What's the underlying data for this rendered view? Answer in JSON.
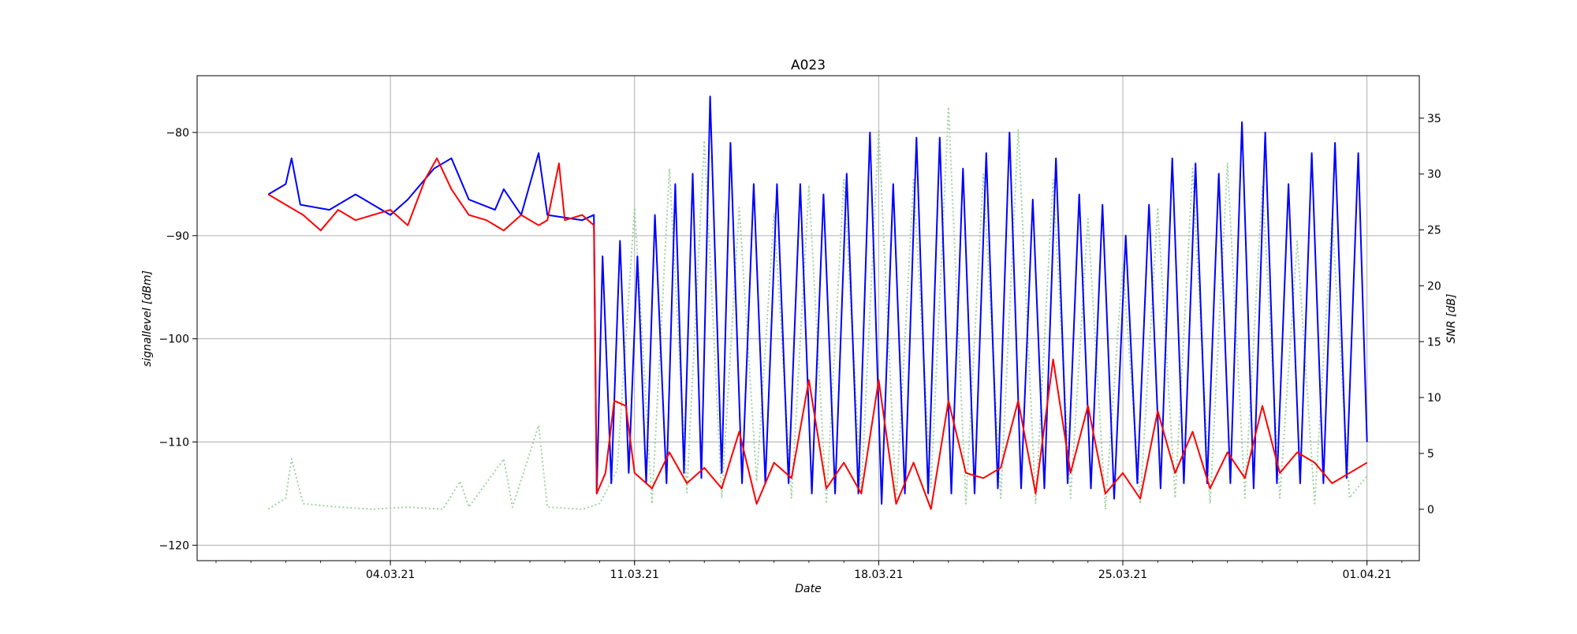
{
  "chart_data": {
    "type": "line",
    "title": "A023",
    "xlabel": "Date",
    "ylabel_left": "signallevel [dBm]",
    "ylabel_right": "SNR [dB]",
    "x_range": [
      "2021-02-26T11:00",
      "2021-04-02T12:00"
    ],
    "ylim_left": [
      -121.5,
      -74.5
    ],
    "ylim_right": [
      -4.6,
      38.8
    ],
    "grid": true,
    "x_ticks": [
      {
        "date": "2021-03-04",
        "label": "04.03.21"
      },
      {
        "date": "2021-03-11",
        "label": "11.03.21"
      },
      {
        "date": "2021-03-18",
        "label": "18.03.21"
      },
      {
        "date": "2021-03-25",
        "label": "25.03.21"
      },
      {
        "date": "2021-04-01",
        "label": "01.04.21"
      }
    ],
    "y_ticks_left": [
      -80,
      -90,
      -100,
      -110,
      -120
    ],
    "y_tick_labels_left": [
      "−80",
      "−90",
      "−100",
      "−110",
      "−120"
    ],
    "y_ticks_right": [
      35,
      30,
      25,
      20,
      15,
      10,
      5,
      0
    ],
    "y_tick_labels_right": [
      "35",
      "30",
      "25",
      "20",
      "15",
      "10",
      "5",
      "0"
    ],
    "series": [
      {
        "axis": "left",
        "color": "#0000ff",
        "style": "solid",
        "points": [
          [
            "2021-02-28T12:00",
            -86.0
          ],
          [
            "2021-03-01T00:00",
            -85.0
          ],
          [
            "2021-03-01T04:00",
            -82.5
          ],
          [
            "2021-03-01T10:00",
            -87.0
          ],
          [
            "2021-03-02T06:00",
            -87.5
          ],
          [
            "2021-03-03T00:00",
            -86.0
          ],
          [
            "2021-03-04T00:00",
            -88.0
          ],
          [
            "2021-03-04T12:00",
            -86.5
          ],
          [
            "2021-03-05T06:00",
            -83.5
          ],
          [
            "2021-03-05T18:00",
            -82.5
          ],
          [
            "2021-03-06T06:00",
            -86.5
          ],
          [
            "2021-03-07T00:00",
            -87.5
          ],
          [
            "2021-03-07T06:00",
            -85.5
          ],
          [
            "2021-03-07T18:00",
            -88.0
          ],
          [
            "2021-03-08T06:00",
            -82.0
          ],
          [
            "2021-03-08T12:00",
            -88.0
          ],
          [
            "2021-03-09T12:00",
            -88.5
          ],
          [
            "2021-03-09T20:00",
            -88.0
          ],
          [
            "2021-03-09T22:00",
            -115.0
          ],
          [
            "2021-03-10T02:00",
            -92.0
          ],
          [
            "2021-03-10T08:00",
            -114.0
          ],
          [
            "2021-03-10T14:00",
            -90.5
          ],
          [
            "2021-03-10T20:00",
            -113.0
          ],
          [
            "2021-03-11T02:00",
            -92.0
          ],
          [
            "2021-03-11T08:00",
            -114.0
          ],
          [
            "2021-03-11T14:00",
            -88.0
          ],
          [
            "2021-03-11T22:00",
            -114.0
          ],
          [
            "2021-03-12T04:00",
            -85.0
          ],
          [
            "2021-03-12T10:00",
            -113.0
          ],
          [
            "2021-03-12T16:00",
            -84.0
          ],
          [
            "2021-03-12T22:00",
            -113.5
          ],
          [
            "2021-03-13T04:00",
            -76.5
          ],
          [
            "2021-03-13T12:00",
            -113.0
          ],
          [
            "2021-03-13T18:00",
            -81.0
          ],
          [
            "2021-03-14T02:00",
            -114.0
          ],
          [
            "2021-03-14T10:00",
            -85.0
          ],
          [
            "2021-03-14T18:00",
            -114.0
          ],
          [
            "2021-03-15T02:00",
            -85.0
          ],
          [
            "2021-03-15T10:00",
            -114.0
          ],
          [
            "2021-03-15T18:00",
            -85.0
          ],
          [
            "2021-03-16T02:00",
            -115.0
          ],
          [
            "2021-03-16T10:00",
            -86.0
          ],
          [
            "2021-03-16T18:00",
            -115.0
          ],
          [
            "2021-03-17T02:00",
            -84.0
          ],
          [
            "2021-03-17T10:00",
            -115.0
          ],
          [
            "2021-03-17T18:00",
            -80.0
          ],
          [
            "2021-03-18T02:00",
            -116.0
          ],
          [
            "2021-03-18T10:00",
            -85.0
          ],
          [
            "2021-03-18T18:00",
            -115.0
          ],
          [
            "2021-03-19T02:00",
            -80.5
          ],
          [
            "2021-03-19T10:00",
            -115.0
          ],
          [
            "2021-03-19T18:00",
            -80.5
          ],
          [
            "2021-03-20T02:00",
            -115.0
          ],
          [
            "2021-03-20T10:00",
            -83.5
          ],
          [
            "2021-03-20T18:00",
            -115.0
          ],
          [
            "2021-03-21T02:00",
            -82.0
          ],
          [
            "2021-03-21T10:00",
            -114.5
          ],
          [
            "2021-03-21T18:00",
            -80.0
          ],
          [
            "2021-03-22T02:00",
            -114.5
          ],
          [
            "2021-03-22T10:00",
            -86.5
          ],
          [
            "2021-03-22T18:00",
            -114.5
          ],
          [
            "2021-03-23T02:00",
            -82.5
          ],
          [
            "2021-03-23T10:00",
            -114.0
          ],
          [
            "2021-03-23T18:00",
            -86.0
          ],
          [
            "2021-03-24T02:00",
            -114.5
          ],
          [
            "2021-03-24T10:00",
            -87.0
          ],
          [
            "2021-03-24T18:00",
            -115.5
          ],
          [
            "2021-03-25T02:00",
            -90.0
          ],
          [
            "2021-03-25T10:00",
            -114.0
          ],
          [
            "2021-03-25T18:00",
            -87.0
          ],
          [
            "2021-03-26T02:00",
            -114.5
          ],
          [
            "2021-03-26T10:00",
            -82.5
          ],
          [
            "2021-03-26T18:00",
            -114.0
          ],
          [
            "2021-03-27T02:00",
            -83.0
          ],
          [
            "2021-03-27T10:00",
            -114.0
          ],
          [
            "2021-03-27T18:00",
            -84.0
          ],
          [
            "2021-03-28T02:00",
            -114.0
          ],
          [
            "2021-03-28T10:00",
            -79.0
          ],
          [
            "2021-03-28T18:00",
            -114.5
          ],
          [
            "2021-03-29T02:00",
            -80.0
          ],
          [
            "2021-03-29T10:00",
            -114.0
          ],
          [
            "2021-03-29T18:00",
            -85.0
          ],
          [
            "2021-03-30T02:00",
            -114.0
          ],
          [
            "2021-03-30T10:00",
            -82.0
          ],
          [
            "2021-03-30T18:00",
            -114.0
          ],
          [
            "2021-03-31T02:00",
            -81.0
          ],
          [
            "2021-03-31T10:00",
            -113.5
          ],
          [
            "2021-03-31T18:00",
            -82.0
          ],
          [
            "2021-04-01T00:00",
            -110.0
          ]
        ]
      },
      {
        "axis": "left",
        "color": "#ff0000",
        "style": "solid",
        "points": [
          [
            "2021-02-28T12:00",
            -86.0
          ],
          [
            "2021-03-01T00:00",
            -87.0
          ],
          [
            "2021-03-01T12:00",
            -88.0
          ],
          [
            "2021-03-02T00:00",
            -89.5
          ],
          [
            "2021-03-02T12:00",
            -87.5
          ],
          [
            "2021-03-03T00:00",
            -88.5
          ],
          [
            "2021-03-03T12:00",
            -88.0
          ],
          [
            "2021-03-04T00:00",
            -87.5
          ],
          [
            "2021-03-04T12:00",
            -89.0
          ],
          [
            "2021-03-05T00:00",
            -84.5
          ],
          [
            "2021-03-05T08:00",
            -82.5
          ],
          [
            "2021-03-05T18:00",
            -85.5
          ],
          [
            "2021-03-06T06:00",
            -88.0
          ],
          [
            "2021-03-06T18:00",
            -88.5
          ],
          [
            "2021-03-07T06:00",
            -89.5
          ],
          [
            "2021-03-07T18:00",
            -88.0
          ],
          [
            "2021-03-08T06:00",
            -89.0
          ],
          [
            "2021-03-08T12:00",
            -88.5
          ],
          [
            "2021-03-08T20:00",
            -83.0
          ],
          [
            "2021-03-09T00:00",
            -88.5
          ],
          [
            "2021-03-09T12:00",
            -88.0
          ],
          [
            "2021-03-09T20:00",
            -89.0
          ],
          [
            "2021-03-09T22:00",
            -115.0
          ],
          [
            "2021-03-10T04:00",
            -113.0
          ],
          [
            "2021-03-10T10:00",
            -106.0
          ],
          [
            "2021-03-10T18:00",
            -106.5
          ],
          [
            "2021-03-11T00:00",
            -113.0
          ],
          [
            "2021-03-11T12:00",
            -114.5
          ],
          [
            "2021-03-12T00:00",
            -111.0
          ],
          [
            "2021-03-12T12:00",
            -114.0
          ],
          [
            "2021-03-13T00:00",
            -112.5
          ],
          [
            "2021-03-13T12:00",
            -114.5
          ],
          [
            "2021-03-14T00:00",
            -109.0
          ],
          [
            "2021-03-14T12:00",
            -116.0
          ],
          [
            "2021-03-15T00:00",
            -112.0
          ],
          [
            "2021-03-15T12:00",
            -113.5
          ],
          [
            "2021-03-16T00:00",
            -104.0
          ],
          [
            "2021-03-16T12:00",
            -114.5
          ],
          [
            "2021-03-17T00:00",
            -112.0
          ],
          [
            "2021-03-17T12:00",
            -115.0
          ],
          [
            "2021-03-18T00:00",
            -104.0
          ],
          [
            "2021-03-18T12:00",
            -116.0
          ],
          [
            "2021-03-19T00:00",
            -112.0
          ],
          [
            "2021-03-19T12:00",
            -116.5
          ],
          [
            "2021-03-20T00:00",
            -106.0
          ],
          [
            "2021-03-20T12:00",
            -113.0
          ],
          [
            "2021-03-21T00:00",
            -113.5
          ],
          [
            "2021-03-21T12:00",
            -112.5
          ],
          [
            "2021-03-22T00:00",
            -106.0
          ],
          [
            "2021-03-22T12:00",
            -115.0
          ],
          [
            "2021-03-23T00:00",
            -102.0
          ],
          [
            "2021-03-23T12:00",
            -113.0
          ],
          [
            "2021-03-24T00:00",
            -106.5
          ],
          [
            "2021-03-24T12:00",
            -115.0
          ],
          [
            "2021-03-25T00:00",
            -113.0
          ],
          [
            "2021-03-25T12:00",
            -115.5
          ],
          [
            "2021-03-26T00:00",
            -107.0
          ],
          [
            "2021-03-26T12:00",
            -113.0
          ],
          [
            "2021-03-27T00:00",
            -109.0
          ],
          [
            "2021-03-27T12:00",
            -114.5
          ],
          [
            "2021-03-28T00:00",
            -111.0
          ],
          [
            "2021-03-28T12:00",
            -113.5
          ],
          [
            "2021-03-29T00:00",
            -106.5
          ],
          [
            "2021-03-29T12:00",
            -113.0
          ],
          [
            "2021-03-30T00:00",
            -111.0
          ],
          [
            "2021-03-30T12:00",
            -112.0
          ],
          [
            "2021-03-31T00:00",
            -114.0
          ],
          [
            "2021-03-31T12:00",
            -113.0
          ],
          [
            "2021-04-01T00:00",
            -112.0
          ]
        ]
      },
      {
        "axis": "right",
        "color": "#9fd39f",
        "style": "dotted",
        "points": [
          [
            "2021-02-28T12:00",
            0.0
          ],
          [
            "2021-03-01T00:00",
            1.0
          ],
          [
            "2021-03-01T04:00",
            4.5
          ],
          [
            "2021-03-01T12:00",
            0.5
          ],
          [
            "2021-03-02T12:00",
            0.2
          ],
          [
            "2021-03-03T12:00",
            0.0
          ],
          [
            "2021-03-04T12:00",
            0.2
          ],
          [
            "2021-03-05T12:00",
            0.0
          ],
          [
            "2021-03-06T00:00",
            2.5
          ],
          [
            "2021-03-06T06:00",
            0.2
          ],
          [
            "2021-03-07T06:00",
            4.5
          ],
          [
            "2021-03-07T12:00",
            0.2
          ],
          [
            "2021-03-08T06:00",
            7.5
          ],
          [
            "2021-03-08T12:00",
            0.2
          ],
          [
            "2021-03-09T12:00",
            0.0
          ],
          [
            "2021-03-10T00:00",
            0.5
          ],
          [
            "2021-03-10T12:00",
            3.5
          ],
          [
            "2021-03-11T00:00",
            27.0
          ],
          [
            "2021-03-11T12:00",
            0.5
          ],
          [
            "2021-03-12T00:00",
            30.5
          ],
          [
            "2021-03-12T12:00",
            1.5
          ],
          [
            "2021-03-13T00:00",
            33.0
          ],
          [
            "2021-03-13T12:00",
            1.0
          ],
          [
            "2021-03-14T00:00",
            27.0
          ],
          [
            "2021-03-14T12:00",
            2.5
          ],
          [
            "2021-03-15T00:00",
            26.5
          ],
          [
            "2021-03-15T12:00",
            1.0
          ],
          [
            "2021-03-16T00:00",
            29.0
          ],
          [
            "2021-03-16T12:00",
            0.5
          ],
          [
            "2021-03-17T00:00",
            29.5
          ],
          [
            "2021-03-17T12:00",
            1.5
          ],
          [
            "2021-03-18T00:00",
            34.0
          ],
          [
            "2021-03-18T12:00",
            0.5
          ],
          [
            "2021-03-19T00:00",
            29.5
          ],
          [
            "2021-03-19T12:00",
            2.0
          ],
          [
            "2021-03-20T00:00",
            36.0
          ],
          [
            "2021-03-20T12:00",
            0.5
          ],
          [
            "2021-03-21T00:00",
            30.0
          ],
          [
            "2021-03-21T12:00",
            1.0
          ],
          [
            "2021-03-22T00:00",
            34.0
          ],
          [
            "2021-03-22T12:00",
            0.5
          ],
          [
            "2021-03-23T00:00",
            29.5
          ],
          [
            "2021-03-23T12:00",
            1.0
          ],
          [
            "2021-03-24T00:00",
            26.0
          ],
          [
            "2021-03-24T12:00",
            0.0
          ],
          [
            "2021-03-25T00:00",
            22.0
          ],
          [
            "2021-03-25T12:00",
            0.5
          ],
          [
            "2021-03-26T00:00",
            27.0
          ],
          [
            "2021-03-26T12:00",
            1.0
          ],
          [
            "2021-03-27T00:00",
            30.5
          ],
          [
            "2021-03-27T12:00",
            0.5
          ],
          [
            "2021-03-28T00:00",
            31.0
          ],
          [
            "2021-03-28T12:00",
            1.0
          ],
          [
            "2021-03-29T00:00",
            29.0
          ],
          [
            "2021-03-29T12:00",
            1.0
          ],
          [
            "2021-03-30T00:00",
            24.0
          ],
          [
            "2021-03-30T12:00",
            0.5
          ],
          [
            "2021-03-31T00:00",
            26.0
          ],
          [
            "2021-03-31T12:00",
            1.0
          ],
          [
            "2021-04-01T00:00",
            3.0
          ]
        ]
      }
    ]
  }
}
